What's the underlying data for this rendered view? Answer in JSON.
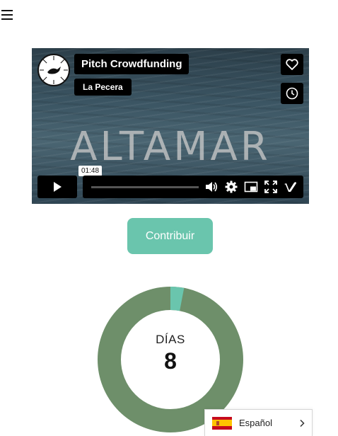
{
  "menu": {
    "icon": "hamburger-icon"
  },
  "video": {
    "title": "Pitch Crowdfunding",
    "channel": "La Pecera",
    "overlay_title": "ALTAMAR",
    "time": "01:48",
    "icons": [
      "heart-icon",
      "clock-icon",
      "play-icon",
      "volume-icon",
      "settings-icon",
      "pip-icon",
      "fullscreen-icon",
      "vimeo-icon"
    ]
  },
  "contribute": {
    "label": "Contribuir"
  },
  "countdown": {
    "label": "DÍAS",
    "value": "8",
    "remaining_fraction": 0.97,
    "colors": {
      "remaining": "#6e8f6a",
      "elapsed": "#6ac5ad"
    }
  },
  "language": {
    "label": "Español",
    "flag": "spain-flag-icon"
  },
  "colors": {
    "accent": "#6ac5ad",
    "ring": "#6e8f6a"
  }
}
